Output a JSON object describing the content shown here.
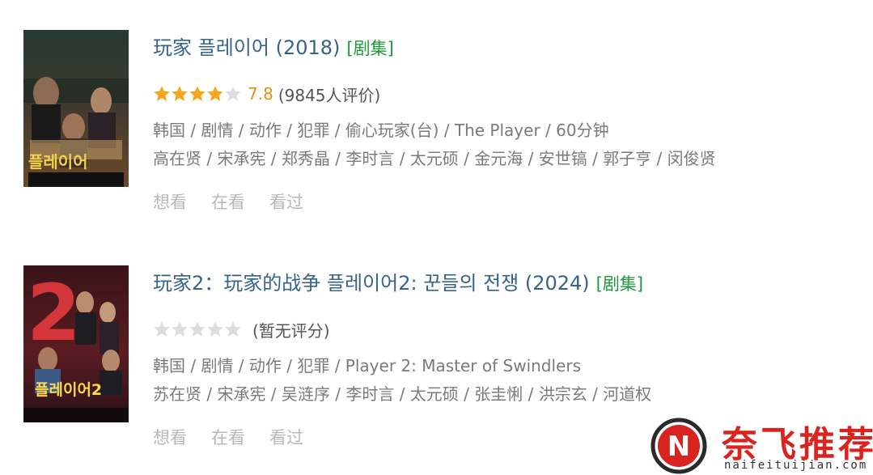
{
  "colors": {
    "title": "#37638a",
    "tag": "#1c9a3a",
    "score": "#e09015",
    "star_full": "#f7a51c",
    "star_empty": "#dddddd",
    "meta": "#7a7a7a",
    "action": "#b8b8b8",
    "watermark": "#d8231f"
  },
  "items": [
    {
      "title": "玩家 플레이어 (2018)",
      "tag": "[剧集]",
      "rating": 3.9,
      "rating_max": 5,
      "score": "7.8",
      "votes": "(9845人评价)",
      "genre_line": "韩国 / 剧情 / 动作 / 犯罪 / 偷心玩家(台) / The Player / 60分钟",
      "cast_line": "高在贤 / 宋承宪 / 郑秀晶 / 李时言 / 太元硕 / 金元海 / 安世镐 / 郭子亨 / 闵俊贤",
      "actions": [
        "想看",
        "在看",
        "看过"
      ],
      "poster_title": "플레이어"
    },
    {
      "title": "玩家2：玩家的战争 플레이어2: 꾼들의 전쟁 (2024)",
      "tag": "[剧集]",
      "rating": 0,
      "rating_max": 5,
      "score": "",
      "votes": "(暂无评分)",
      "genre_line": "韩国 / 剧情 / 动作 / 犯罪 / Player 2: Master of Swindlers",
      "cast_line": "苏在贤 / 宋承宪 / 吴涟序 / 李时言 / 太元硕 / 张圭悧 / 洪宗玄 / 河道权",
      "actions": [
        "想看",
        "在看",
        "看过"
      ],
      "poster_title": "플레이어2",
      "poster_numeral": "2"
    }
  ],
  "watermark": {
    "logo_letter": "N",
    "text": "奈飞推荐",
    "url": "naifeituijian.com"
  }
}
